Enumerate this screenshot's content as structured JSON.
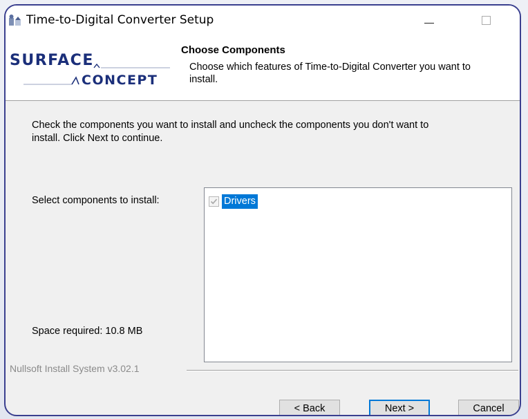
{
  "window": {
    "title": "Time-to-Digital Converter Setup"
  },
  "header": {
    "logo_text_top": "SURFACE",
    "logo_text_bottom": "CONCEPT",
    "title": "Choose Components",
    "subtitle_line1": "Choose which features of Time-to-Digital Converter you want to",
    "subtitle_line2": "install."
  },
  "body": {
    "instructions_line1": "Check the components you want to install and uncheck the components you don't want to",
    "instructions_line2": "install. Click Next to continue.",
    "select_label": "Select components to install:",
    "space_required": "Space required: 10.8 MB",
    "components": [
      {
        "label": "Drivers",
        "checked": true,
        "disabled": true,
        "selected": true
      }
    ]
  },
  "footer": {
    "branding": "Nullsoft Install System v3.02.1",
    "back_label": "< Back",
    "next_label": "Next >",
    "cancel_label": "Cancel"
  },
  "colors": {
    "frame": "#3a3f8f",
    "selection": "#0078d7",
    "logo": "#1b2f7a"
  }
}
